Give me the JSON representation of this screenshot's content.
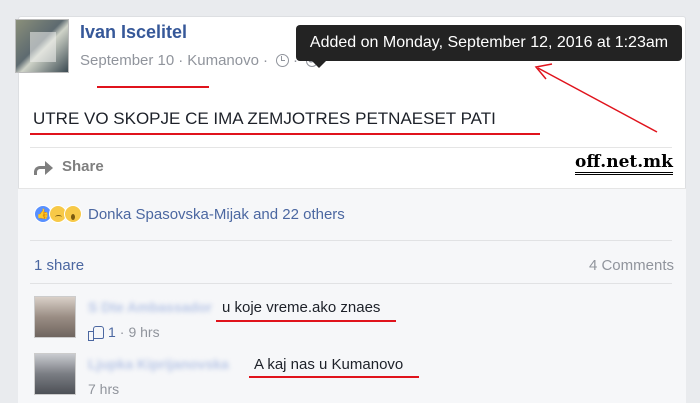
{
  "post": {
    "author": "Ivan Iscelitel",
    "date": "September 10",
    "location": "Kumanovo",
    "separator": "·",
    "text": "UTRE VO SKOPJE CE IMA ZEMJOTRES PETNAESET PATI",
    "share_label": "Share"
  },
  "tooltip": {
    "text": "Added on Monday, September 12, 2016 at 1:23am"
  },
  "watermark": "off.net.mk",
  "reactions": {
    "icons": [
      "like-icon",
      "sad-icon",
      "wow-icon"
    ],
    "names": "Donka Spasovska-Mijak and 22 others"
  },
  "stats": {
    "shares": "1 share",
    "comments": "4 Comments"
  },
  "comments": [
    {
      "author": "S Dte Ambassador",
      "text": "u koje vreme.ako znaes",
      "likes": "1",
      "time": "9 hrs",
      "separator": "·"
    },
    {
      "author": "Ljupka Kiprijanovska",
      "text": "A kaj nas u Kumanovo",
      "time": "7 hrs"
    }
  ],
  "colors": {
    "link": "#365899",
    "annotation_red": "#e0131c",
    "tooltip_bg": "#232323"
  }
}
